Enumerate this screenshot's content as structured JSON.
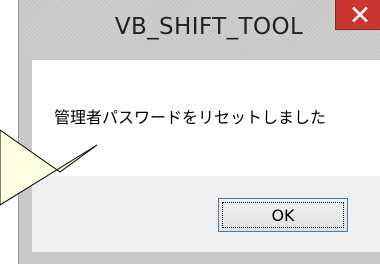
{
  "dialog": {
    "title": "VB_SHIFT_TOOL",
    "message": "管理者パスワードをリセットしました",
    "ok_label": "OK",
    "close_icon": "close-icon"
  },
  "callout": {
    "icon": "speech-callout"
  },
  "colors": {
    "close_button": "#c7362f",
    "titlebar": "#cbcbcb",
    "content_bg": "#ffffff",
    "footer_bg": "#f0f0f0",
    "ok_border": "#3c7fb1",
    "callout_fill": "#ffffe1"
  }
}
